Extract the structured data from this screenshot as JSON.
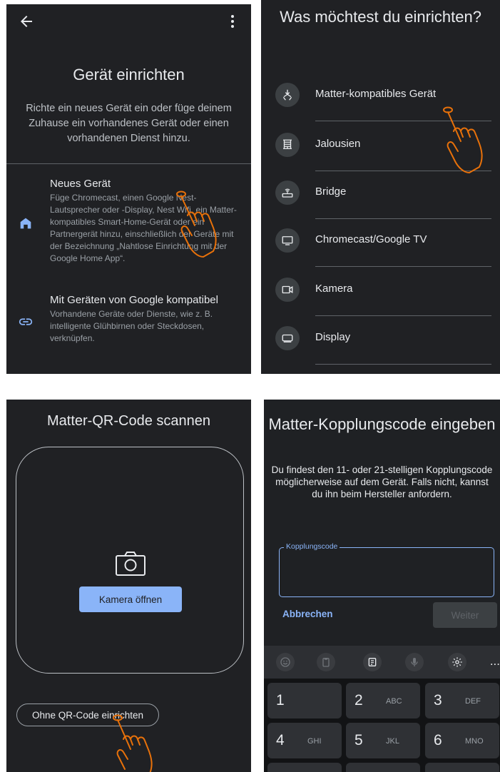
{
  "panel1": {
    "title": "Gerät einrichten",
    "subtitle": "Richte ein neues Gerät ein oder füge deinem Zuhause ein vorhandenes Gerät oder einen vorhandenen Dienst hinzu.",
    "options": [
      {
        "title": "Neues Gerät",
        "description": "Füge Chromecast, einen Google Nest-Lautsprecher oder -Display, Nest Wifi, ein Matter-kompatibles Smart-Home-Gerät oder ein Partnergerät hinzu, einschließlich der Geräte mit der Bezeichnung „Nahtlose Einrichtung mit der Google Home App“.",
        "icon": "home-icon"
      },
      {
        "title": "Mit Geräten von Google kompatibel",
        "description": "Vorhandene Geräte oder Dienste, wie z. B. intelligente Glühbirnen oder Steckdosen, verknüpfen.",
        "icon": "link-icon"
      }
    ]
  },
  "panel2": {
    "title": "Was möchtest du einrichten?",
    "items": [
      {
        "label": "Matter-kompatibles Gerät",
        "icon": "matter-icon"
      },
      {
        "label": "Jalousien",
        "icon": "blinds-icon"
      },
      {
        "label": "Bridge",
        "icon": "router-icon"
      },
      {
        "label": "Chromecast/Google TV",
        "icon": "tv-icon"
      },
      {
        "label": "Kamera",
        "icon": "camera-icon"
      },
      {
        "label": "Display",
        "icon": "display-icon"
      }
    ]
  },
  "panel3": {
    "title": "Matter-QR-Code scannen",
    "camera_button": "Kamera öffnen",
    "no_qr_button": "Ohne QR-Code einrichten"
  },
  "panel4": {
    "title": "Matter-Kopplungscode eingeben",
    "description": "Du findest den 11- oder 21-stelligen Kopplungscode möglicherweise auf dem Gerät. Falls nicht, kannst du ihn beim Hersteller anfordern.",
    "field_label": "Kopplungscode",
    "field_value": "",
    "cancel_label": "Abbrechen",
    "next_label": "Weiter",
    "keyboard_more": "...",
    "keys": [
      {
        "num": "1",
        "letters": ""
      },
      {
        "num": "2",
        "letters": "ABC"
      },
      {
        "num": "3",
        "letters": "DEF"
      },
      {
        "num": "4",
        "letters": "GHI"
      },
      {
        "num": "5",
        "letters": "JKL"
      },
      {
        "num": "6",
        "letters": "MNO"
      }
    ]
  },
  "colors": {
    "accent": "#8ab4f8",
    "background": "#202124",
    "hand_pointer": "#e8710a"
  }
}
